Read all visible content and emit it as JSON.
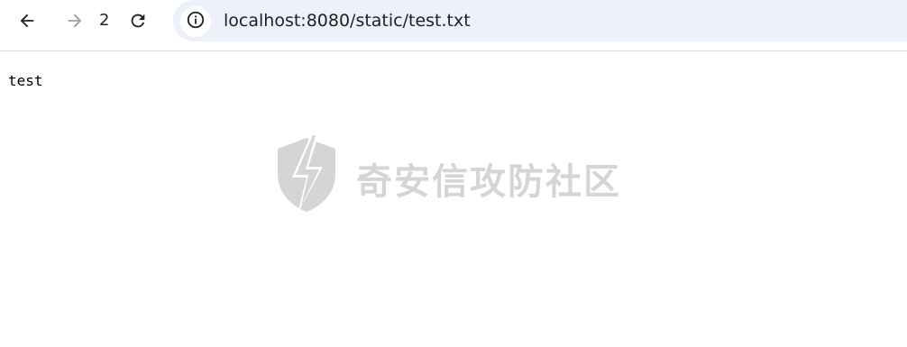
{
  "toolbar": {
    "back_icon": "arrow-left-icon",
    "forward_icon": "arrow-right-icon",
    "step_count": "2",
    "reload_icon": "reload-icon"
  },
  "omnibox": {
    "site_info_icon": "info-circle-icon",
    "url": "localhost:8080/static/test.txt"
  },
  "page": {
    "body_text": "test"
  },
  "watermark": {
    "text": "奇安信攻防社区",
    "logo_icon": "shield-lightning-icon"
  },
  "colors": {
    "omnibox_bg": "#edf1f9",
    "text": "#202124",
    "forward_disabled": "#9aa0a6"
  }
}
